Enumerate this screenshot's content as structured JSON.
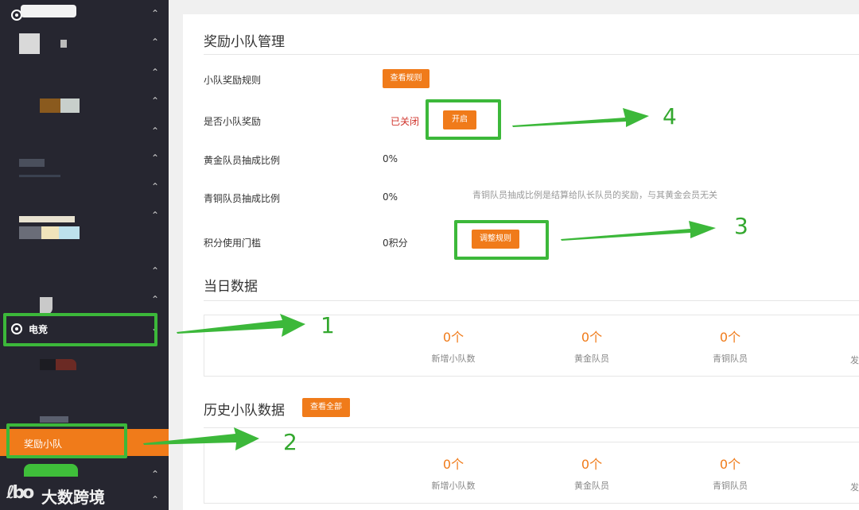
{
  "sidebar": {
    "esports_label": "电竞",
    "reward_team_label": "奖励小队",
    "watermark_text": "大数跨境",
    "watermark_logo_text": "ℓbo"
  },
  "main": {
    "title": "奖励小队管理",
    "rows": {
      "rules_label": "小队奖励规则",
      "rules_button": "查看规则",
      "enabled_label": "是否小队奖励",
      "enabled_status": "已关闭",
      "enable_button": "开启",
      "gold_ratio_label": "黄金队员抽成比例",
      "gold_ratio_value": "0%",
      "bronze_ratio_label": "青铜队员抽成比例",
      "bronze_ratio_value": "0%",
      "bronze_note": "青铜队员抽成比例是结算给队长队员的奖励，与其黄金会员无关",
      "points_label": "积分使用门槛",
      "points_value": "0积分",
      "adjust_button": "调整规则"
    },
    "daily": {
      "title": "当日数据",
      "stats": [
        {
          "value": "0个",
          "label": "新增小队数"
        },
        {
          "value": "0个",
          "label": "黄金队员"
        },
        {
          "value": "0个",
          "label": "青铜队员"
        }
      ],
      "partial_label": "发"
    },
    "history": {
      "title": "历史小队数据",
      "view_all_button": "查看全部",
      "stats": [
        {
          "value": "0个",
          "label": "新增小队数"
        },
        {
          "value": "0个",
          "label": "黄金队员"
        },
        {
          "value": "0个",
          "label": "青铜队员"
        }
      ],
      "partial_label": "发"
    }
  },
  "annotations": {
    "n1": "1",
    "n2": "2",
    "n3": "3",
    "n4": "4"
  },
  "colors": {
    "accent": "#f07b1a",
    "sidebar_bg": "#262630",
    "annotation_green": "#3cb83a",
    "closed_red": "#d0342c"
  }
}
